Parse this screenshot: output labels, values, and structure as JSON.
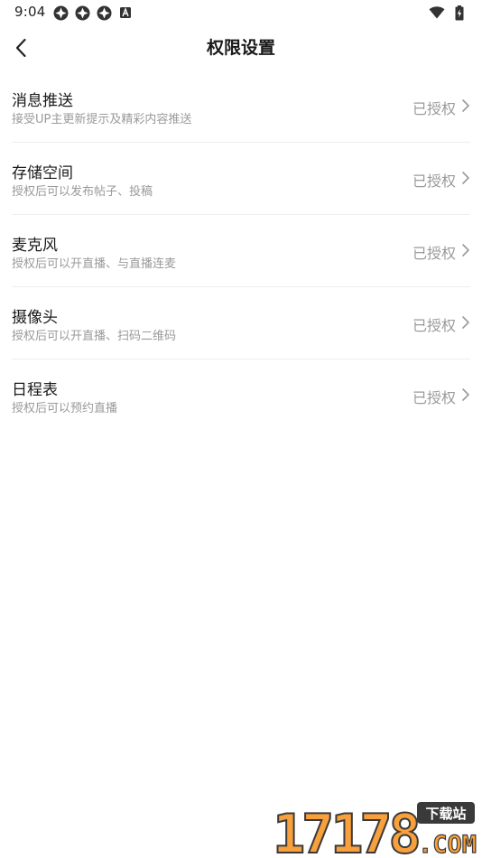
{
  "status_bar": {
    "time": "9:04",
    "left_icons": [
      "app-notification-icon",
      "app-notification-icon",
      "app-notification-icon",
      "font-a-icon"
    ],
    "right_icons": [
      "wifi-icon",
      "battery-charging-icon"
    ]
  },
  "header": {
    "title": "权限设置",
    "back_icon": "chevron-left-icon"
  },
  "permissions": [
    {
      "name": "消息推送",
      "desc": "接受UP主更新提示及精彩内容推送",
      "status": "已授权"
    },
    {
      "name": "存储空间",
      "desc": "授权后可以发布帖子、投稿",
      "status": "已授权"
    },
    {
      "name": "麦克风",
      "desc": "授权后可以开直播、与直播连麦",
      "status": "已授权"
    },
    {
      "name": "摄像头",
      "desc": "授权后可以开直播、扫码二维码",
      "status": "已授权"
    },
    {
      "name": "日程表",
      "desc": "授权后可以预约直播",
      "status": "已授权"
    }
  ],
  "watermark": {
    "number": "17178",
    "badge": "下载站",
    "domain": ".COM"
  },
  "colors": {
    "text_primary": "#1a1a1a",
    "text_secondary": "#9a9a9a",
    "divider": "#eeeeee",
    "watermark_orange": "#f7a03c",
    "watermark_dark": "#3a3a3a"
  }
}
